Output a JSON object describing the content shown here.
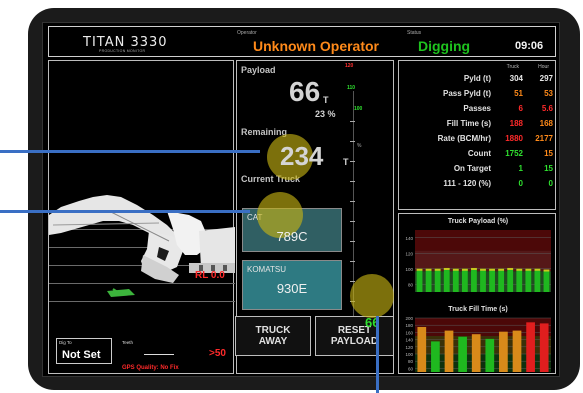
{
  "header": {
    "logo": "TITAN 3330",
    "logo_sub": "PRODUCTION MONITOR",
    "operator_label": "Operator",
    "operator": "Unknown Operator",
    "status_label": "Status",
    "status": "Digging",
    "time": "09:06"
  },
  "left_panel": {
    "rl": "RL 0.0",
    "dig_to_label": "Dig To",
    "dig_to_value": "Not Set",
    "teeth_label": "Teeth",
    "teeth_value": ">50",
    "gps": "GPS Quality:  No Fix"
  },
  "payload": {
    "label": "Payload",
    "value": "66",
    "unit": "T",
    "percent": "23 %",
    "remaining_label": "Remaining",
    "remaining_value": "234",
    "remaining_unit": "T",
    "current_truck_label": "Current Truck",
    "scale_red": "120",
    "scale_green_1": "110",
    "scale_green_2": "100",
    "scale_pct_unit": "%",
    "level_value": "66"
  },
  "trucks": [
    {
      "make": "CAT",
      "model": "789C"
    },
    {
      "make": "KOMATSU",
      "model": "930E"
    }
  ],
  "buttons": {
    "truck_away": "TRUCK\nAWAY",
    "reset_payload": "RESET\nPAYLOAD"
  },
  "stats": {
    "col_truck": "Truck",
    "col_hour": "Hour",
    "rows": [
      {
        "label": "Pyld (t)",
        "truck": "304",
        "hour": "297",
        "truck_color": "#e8e8e8",
        "hour_color": "#e8e8e8"
      },
      {
        "label": "Pass Pyld (t)",
        "truck": "51",
        "hour": "53",
        "truck_color": "#ff8a1a",
        "hour_color": "#ff8a1a"
      },
      {
        "label": "Passes",
        "truck": "6",
        "hour": "5.6",
        "truck_color": "#ff2a2a",
        "hour_color": "#ff2a2a"
      },
      {
        "label": "Fill Time (s)",
        "truck": "188",
        "hour": "168",
        "truck_color": "#ff2a2a",
        "hour_color": "#ff8a1a"
      },
      {
        "label": "Rate (BCM/hr)",
        "truck": "1880",
        "hour": "2177",
        "truck_color": "#ff2a2a",
        "hour_color": "#ff8a1a"
      },
      {
        "label": "Count",
        "truck": "1752",
        "hour": "15",
        "truck_color": "#2fe02f",
        "hour_color": "#ff8a1a"
      },
      {
        "label": "On Target",
        "truck": "1",
        "hour": "15",
        "truck_color": "#2fe02f",
        "hour_color": "#2fe02f"
      },
      {
        "label": "111 - 120 (%)",
        "truck": "0",
        "hour": "0",
        "truck_color": "#2fe02f",
        "hour_color": "#2fe02f"
      }
    ]
  },
  "charts": {
    "payload_title": "Truck Payload (%)",
    "fill_title": "Truck Fill Time (s)"
  },
  "chart_data": [
    {
      "type": "bar",
      "title": "Truck Payload (%)",
      "ylim": [
        70,
        150
      ],
      "yticks": [
        "140",
        "120",
        "100",
        "80"
      ],
      "values": [
        100,
        100,
        100,
        101,
        100,
        100,
        101,
        100,
        100,
        100,
        101,
        100,
        100,
        100,
        99
      ],
      "bar_color": "#1fb81f",
      "cap_color": "#c8c81e",
      "band_colors": [
        "#8a0f0f",
        "#9a2c2c",
        "#3a8a3a"
      ]
    },
    {
      "type": "bar",
      "title": "Truck Fill Time (s)",
      "ylim": [
        50,
        200
      ],
      "yticks": [
        "200",
        "180",
        "160",
        "140",
        "120",
        "100",
        "80",
        "60"
      ],
      "values": [
        175,
        135,
        165,
        148,
        155,
        142,
        162,
        165,
        188,
        185
      ],
      "bar_colors": [
        "#d88a1a",
        "#1fb81f",
        "#d88a1a",
        "#1fb81f",
        "#d88a1a",
        "#1fb81f",
        "#d88a1a",
        "#d88a1a",
        "#e01e1e",
        "#e01e1e"
      ],
      "band_colors": [
        "#8a0f0f",
        "#6a5a10",
        "#1a5a1a"
      ]
    }
  ]
}
